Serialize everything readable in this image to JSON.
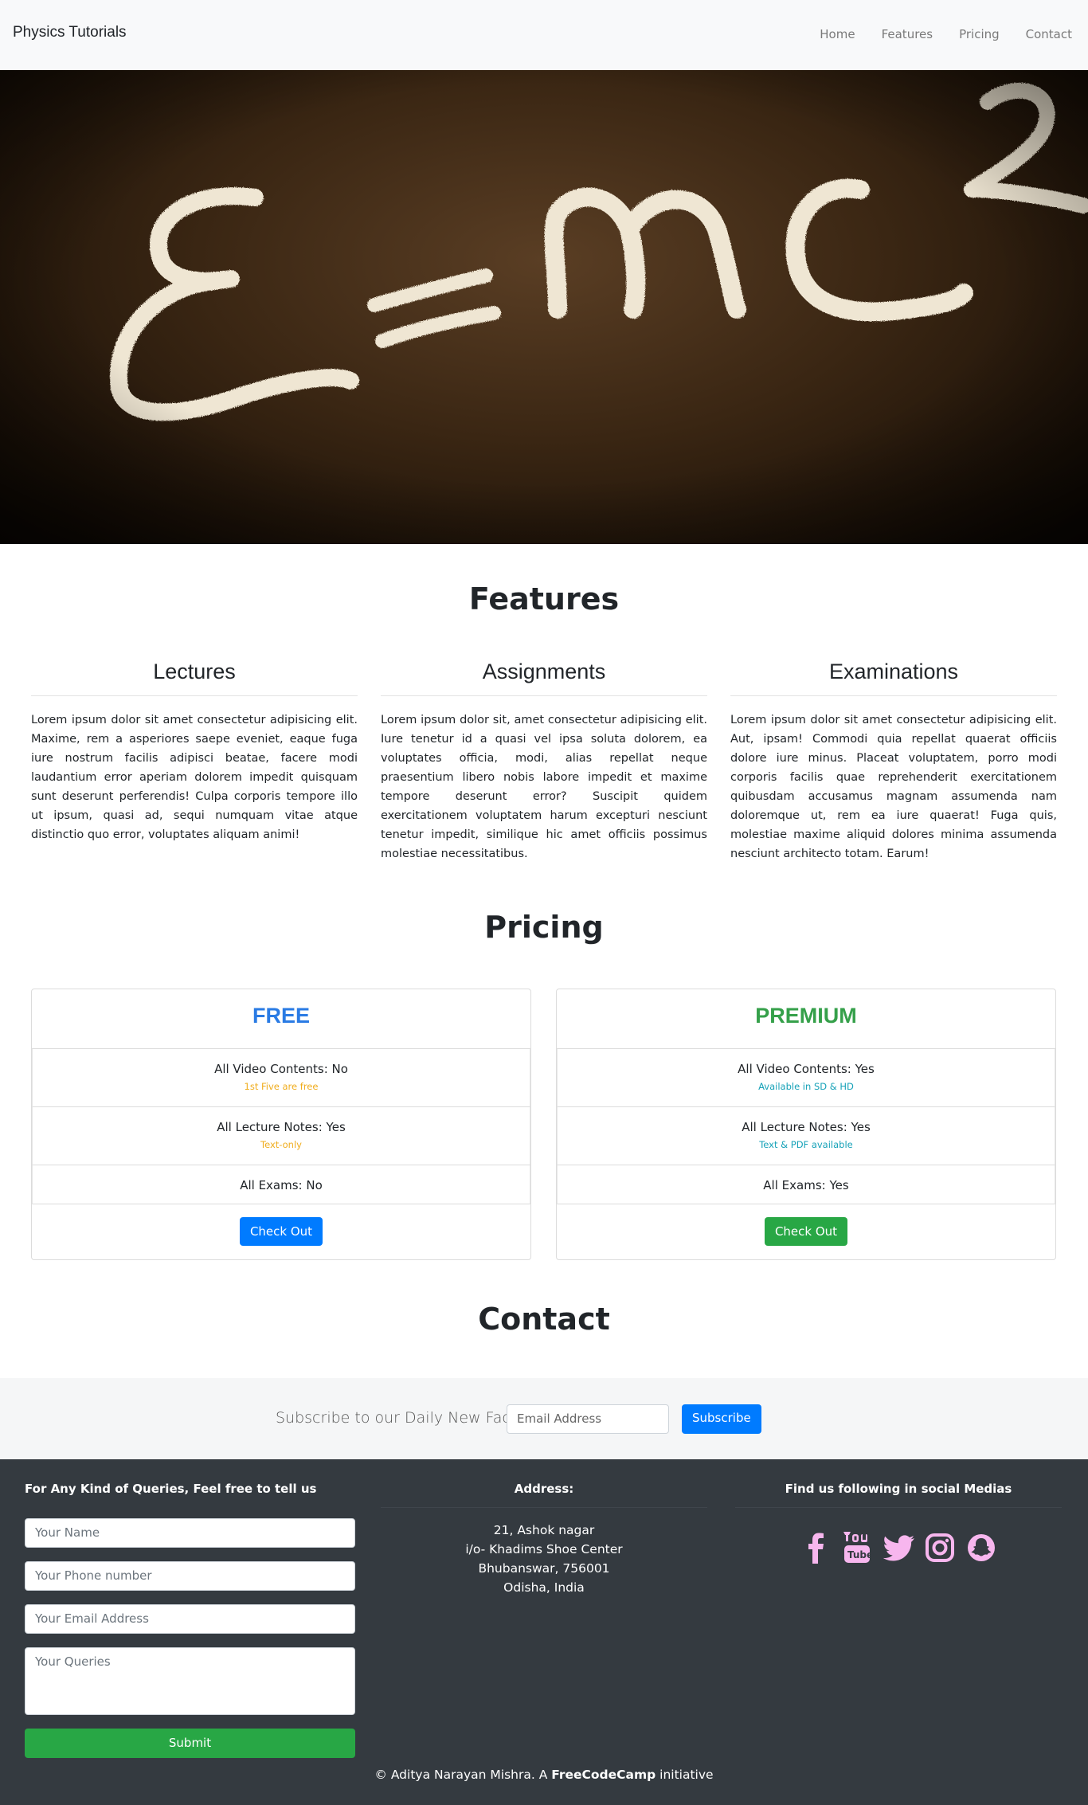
{
  "nav": {
    "brand": "Physics Tutorials",
    "links": [
      "Home",
      "Features",
      "Pricing",
      "Contact"
    ]
  },
  "hero": {
    "formula": "E=mc²",
    "alt": "E=mc2 chalk"
  },
  "features": {
    "title": "Features",
    "cols": [
      {
        "heading": "Lectures",
        "text": "Lorem ipsum dolor sit amet consectetur adipisicing elit. Maxime, rem a asperiores saepe eveniet, eaque fuga iure nostrum facilis adipisci beatae, facere modi laudantium error aperiam dolorem impedit quisquam sunt deserunt perferendis! Culpa corporis tempore illo ut ipsum, quasi ad, sequi numquam vitae atque distinctio quo error, voluptates aliquam animi!"
      },
      {
        "heading": "Assignments",
        "text": "Lorem ipsum dolor sit, amet consectetur adipisicing elit. Iure tenetur id a quasi vel ipsa soluta dolorem, ea voluptates officia, modi, alias repellat neque praesentium libero nobis labore impedit et maxime tempore deserunt error? Suscipit quidem exercitationem voluptatem harum excepturi nesciunt tenetur impedit, similique hic amet officiis possimus molestiae necessitatibus."
      },
      {
        "heading": "Examinations",
        "text": "Lorem ipsum dolor sit amet consectetur adipisicing elit. Aut, ipsam! Commodi quia repellat quaerat officiis dolore iure minus. Placeat voluptatem, porro modi corporis facilis quae reprehenderit exercitationem quibusdam accusamus magnam assumenda nam doloremque ut, rem ea iure quaerat! Fuga quis, molestiae maxime aliquid dolores minima assumenda nesciunt architecto totam. Earum!"
      }
    ]
  },
  "pricing": {
    "title": "Pricing",
    "free": {
      "name": "FREE",
      "rows": [
        {
          "label": "All Video Contents: ",
          "value": "No",
          "note": "1st Five are free"
        },
        {
          "label": "All Lecture Notes: ",
          "value": "Yes",
          "note": "Text-only"
        },
        {
          "label": "All Exams: ",
          "value": "No"
        }
      ],
      "button": "Check Out"
    },
    "premium": {
      "name": "PREMIUM",
      "rows": [
        {
          "label": "All Video Contents: ",
          "value": "Yes",
          "note": "Available in SD & HD"
        },
        {
          "label": "All Lecture Notes: ",
          "value": "Yes",
          "note": "Text & PDF available"
        },
        {
          "label": "All Exams: ",
          "value": "Yes"
        }
      ],
      "button": "Check Out"
    }
  },
  "contact": {
    "title": "Contact",
    "subscribe_label": "Subscribe to our Daily New Facts :",
    "email_placeholder": "Email Address",
    "subscribe_button": "Subscribe"
  },
  "footer": {
    "queries_heading": "For Any Kind of Queries, Feel free to tell us",
    "name_placeholder": "Your Name",
    "phone_placeholder": "Your Phone number",
    "email_placeholder": "Your Email Address",
    "queries_placeholder": "Your Queries",
    "submit": "Submit",
    "address_heading": "Address:",
    "address_lines": [
      "21, Ashok nagar",
      "i/o- Khadims Shoe Center",
      "Bhubanswar, 756001",
      "Odisha, India"
    ],
    "social_heading": "Find us following in social Medias",
    "social_icons": [
      "facebook-icon",
      "youtube-icon",
      "twitter-icon",
      "instagram-icon",
      "snapchat-icon"
    ],
    "social_color": "#f7b6ee",
    "copyright_pre": "© Aditya Narayan Mishra. A ",
    "copyright_bold": "FreeCodeCamp",
    "copyright_post": " initiative"
  },
  "colors": {
    "primary": "#007bff",
    "success": "#28a745",
    "danger": "#dc3545",
    "warning": "#f0ad1e",
    "info": "#17a2b8",
    "footer_bg": "#343a40"
  }
}
